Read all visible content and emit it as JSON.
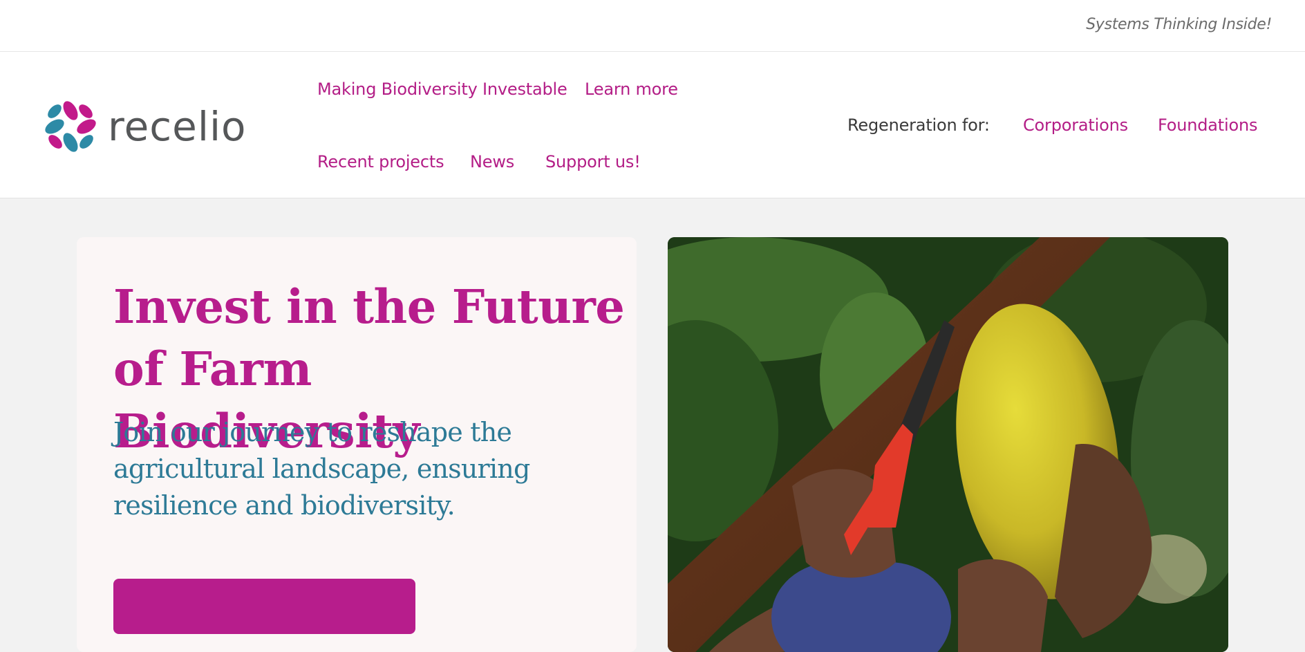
{
  "topbar": {
    "tagline": "Systems Thinking Inside!"
  },
  "brand": {
    "name": "recelio",
    "petal_colors": [
      "#2d8aa6",
      "#c21a8a"
    ]
  },
  "nav": {
    "primary": [
      {
        "label": "Making Biodiversity Investable"
      },
      {
        "label": "Learn more"
      },
      {
        "label": "Recent projects"
      },
      {
        "label": "News"
      },
      {
        "label": "Support us!"
      }
    ],
    "regeneration": {
      "label": "Regeneration for:",
      "links": [
        {
          "label": "Corporations"
        },
        {
          "label": "Foundations"
        }
      ]
    }
  },
  "hero": {
    "title": "Invest in the Future of Farm Biodiversity",
    "subtitle": "Join our journey to reshape the agricultural landscape, ensuring resilience and biodiversity.",
    "cta_label": ""
  },
  "colors": {
    "accent": "#b71d8c",
    "subtitle": "#2d7a96",
    "card_bg": "#fbf6f6",
    "page_bg": "#f2f2f2"
  }
}
